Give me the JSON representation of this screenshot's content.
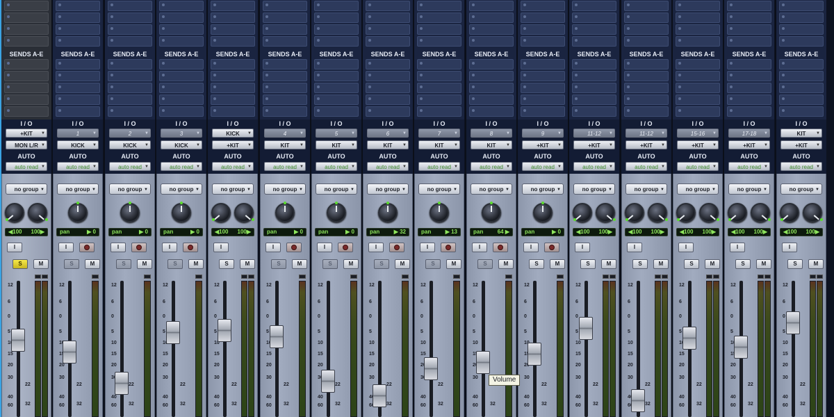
{
  "labels": {
    "sends": "SENDS A-E",
    "io": "I / O",
    "auto": "AUTO",
    "volume_tooltip": "Volume"
  },
  "scale_marks": [
    "12",
    "6",
    "0",
    "5",
    "10",
    "15",
    "20",
    "30",
    "40",
    "60"
  ],
  "scale_marks_lower": [
    "22",
    "32"
  ],
  "knob_led_color": "#5bdc2e",
  "channels": [
    {
      "id": "ch1",
      "stereo": true,
      "input": "+KIT",
      "output": "MON L/R",
      "input_style": "light",
      "auto_mode": "auto read",
      "group": "no group",
      "pan_left": "◀100",
      "pan_right": "100▶",
      "record": false,
      "solo": "S",
      "mute": "M",
      "solo_on": true,
      "solo_dim": false,
      "fader_level": 0.38
    },
    {
      "id": "ch2",
      "stereo": false,
      "input": "1",
      "output": "KICK",
      "input_style": "grey",
      "auto_mode": "auto read",
      "group": "no group",
      "pan_label": "pan",
      "pan_value": "▶ 0",
      "record": true,
      "solo": "S",
      "mute": "M",
      "solo_on": false,
      "solo_dim": true,
      "fader_level": 0.5
    },
    {
      "id": "ch3",
      "stereo": false,
      "input": "2",
      "output": "KICK",
      "input_style": "grey",
      "auto_mode": "auto read",
      "group": "no group",
      "pan_label": "pan",
      "pan_value": "▶ 0",
      "record": true,
      "solo": "S",
      "mute": "M",
      "solo_on": false,
      "solo_dim": true,
      "fader_level": 0.82
    },
    {
      "id": "ch4",
      "stereo": false,
      "input": "3",
      "output": "KICK",
      "input_style": "grey",
      "auto_mode": "auto read",
      "group": "no group",
      "pan_label": "pan",
      "pan_value": "▶ 0",
      "record": true,
      "solo": "S",
      "mute": "M",
      "solo_on": false,
      "solo_dim": true,
      "fader_level": 0.3
    },
    {
      "id": "ch5",
      "stereo": true,
      "input": "KICK",
      "output": "+KIT",
      "input_style": "light",
      "auto_mode": "auto read",
      "group": "no group",
      "pan_left": "◀100",
      "pan_right": "100▶",
      "record": false,
      "solo": "S",
      "mute": "M",
      "solo_on": false,
      "solo_dim": false,
      "fader_level": 0.28
    },
    {
      "id": "ch6",
      "stereo": false,
      "input": "4",
      "output": "KIT",
      "input_style": "grey",
      "auto_mode": "auto read",
      "group": "no group",
      "pan_label": "pan",
      "pan_value": "▶ 0",
      "record": true,
      "solo": "S",
      "mute": "M",
      "solo_on": false,
      "solo_dim": true,
      "fader_level": 0.34
    },
    {
      "id": "ch7",
      "stereo": false,
      "input": "5",
      "output": "KIT",
      "input_style": "grey",
      "auto_mode": "auto read",
      "group": "no group",
      "pan_label": "pan",
      "pan_value": "▶ 0",
      "record": true,
      "solo": "S",
      "mute": "M",
      "solo_on": false,
      "solo_dim": true,
      "fader_level": 0.8
    },
    {
      "id": "ch8",
      "stereo": false,
      "input": "6",
      "output": "KIT",
      "input_style": "grey",
      "auto_mode": "auto read",
      "group": "no group",
      "pan_label": "pan",
      "pan_value": "▶ 32",
      "record": true,
      "solo": "S",
      "mute": "M",
      "solo_on": false,
      "solo_dim": true,
      "fader_level": 0.95
    },
    {
      "id": "ch9",
      "stereo": false,
      "input": "7",
      "output": "KIT",
      "input_style": "grey",
      "auto_mode": "auto read",
      "group": "no group",
      "pan_label": "pan",
      "pan_value": "▶ 13",
      "record": true,
      "solo": "S",
      "mute": "M",
      "solo_on": false,
      "solo_dim": true,
      "fader_level": 0.67
    },
    {
      "id": "ch10",
      "stereo": false,
      "input": "8",
      "output": "KIT",
      "input_style": "grey",
      "auto_mode": "auto read",
      "group": "no group",
      "pan_label": "pan",
      "pan_value": "64 ▶",
      "record": true,
      "solo": "S",
      "mute": "M",
      "solo_on": false,
      "solo_dim": true,
      "fader_level": 0.61
    },
    {
      "id": "ch11",
      "stereo": false,
      "input": "9",
      "output": "+KIT",
      "input_style": "grey",
      "auto_mode": "auto read",
      "group": "no group",
      "pan_label": "pan",
      "pan_value": "▶ 0",
      "record": true,
      "solo": "S",
      "mute": "M",
      "solo_on": false,
      "solo_dim": false,
      "fader_level": 0.52
    },
    {
      "id": "ch12",
      "stereo": true,
      "input": "11-12",
      "output": "+KIT",
      "input_style": "grey",
      "auto_mode": "auto read",
      "group": "no group",
      "pan_left": "◀100",
      "pan_right": "100▶",
      "record": false,
      "solo": "S",
      "mute": "M",
      "solo_on": false,
      "solo_dim": false,
      "fader_level": 0.26
    },
    {
      "id": "ch13",
      "stereo": true,
      "input": "11-12",
      "output": "+KIT",
      "input_style": "grey",
      "auto_mode": "auto read",
      "group": "no group",
      "pan_left": "◀100",
      "pan_right": "100▶",
      "record": false,
      "solo": "S",
      "mute": "M",
      "solo_on": false,
      "solo_dim": false,
      "fader_level": 1.0
    },
    {
      "id": "ch14",
      "stereo": true,
      "input": "15-16",
      "output": "+KIT",
      "input_style": "grey",
      "auto_mode": "auto read",
      "group": "no group",
      "pan_left": "◀100",
      "pan_right": "100▶",
      "record": false,
      "solo": "S",
      "mute": "M",
      "solo_on": false,
      "solo_dim": false,
      "fader_level": 0.36
    },
    {
      "id": "ch15",
      "stereo": true,
      "input": "17-18",
      "output": "+KIT",
      "input_style": "grey",
      "auto_mode": "auto read",
      "group": "no group",
      "pan_left": "◀100",
      "pan_right": "100▶",
      "record": false,
      "solo": "S",
      "mute": "M",
      "solo_on": false,
      "solo_dim": false,
      "fader_level": 0.45
    },
    {
      "id": "ch16",
      "stereo": true,
      "input": "KIT",
      "output": "+KIT",
      "input_style": "light",
      "auto_mode": "auto read",
      "group": "no group",
      "pan_left": "◀100",
      "pan_right": "100▶",
      "record": false,
      "solo": "S",
      "mute": "M",
      "solo_on": false,
      "solo_dim": false,
      "fader_level": 0.2
    }
  ]
}
